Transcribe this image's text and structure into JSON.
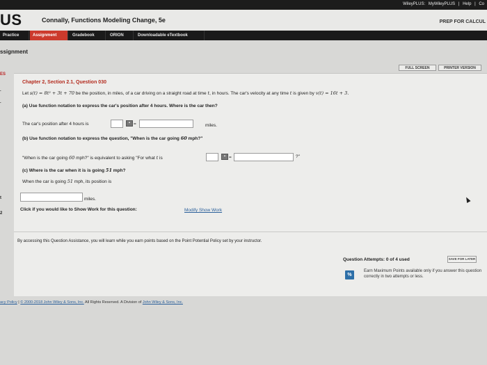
{
  "topbar": {
    "links": [
      "WileyPLUS:",
      "MyWileyPLUS",
      "|",
      "Help",
      "|",
      "Co"
    ]
  },
  "header": {
    "brand": "US",
    "course_title": "Connally, Functions Modeling Change, 5e",
    "prep": "PREP FOR CALCUL"
  },
  "nav": {
    "tabs": [
      "Practice",
      "Assignment",
      "Gradebook",
      "ORION",
      "Downloadable eTextbook"
    ],
    "active": "Assignment"
  },
  "section_label": "ssignment",
  "buttons": {
    "full_screen": "FULL SCREEN",
    "printer_version": "PRINTER VERSION"
  },
  "sidebar": {
    "top": "ES",
    "dot1": ".",
    "dot2": ".",
    "mark1": "t",
    "mark2": "2"
  },
  "question": {
    "title": "Chapter 2, Section 2.1, Question 030",
    "intro_a": "Let ",
    "position_fn": "s(t) = 8t² + 3t + 70",
    "intro_b": " be the position, in miles, of a car driving on a straight road at time ",
    "t_var": "t",
    "intro_c": ", in hours. The car's velocity at any time ",
    "intro_d": " is given by ",
    "velocity_fn": "v(t) = 16t + 3.",
    "part_a": "(a) Use function notation to express the car's position after 4 hours. Where is the car then?",
    "pos_prefix": "The car's position after 4 hours is",
    "eq": "=",
    "miles": "miles.",
    "part_b_a": "(b) Use function notation to express the question, \"When is the car going ",
    "part_b_num": "60",
    "part_b_b": " mph?\"",
    "when_a": "\"When is the car going ",
    "when_num": "60",
    "when_b": " mph?\" is equivalent to asking \"For what ",
    "when_c": " is",
    "close_q": "?\"",
    "part_c_a": "(c) Where is the car when it is is going ",
    "part_c_num": "51",
    "part_c_b": " mph?",
    "going_a": "When the car is going ",
    "going_num": "51",
    "going_b": " mph, its position is",
    "miles2": "miles.",
    "show_work_label": "Click if you would like to Show Work for this question:",
    "show_work_link": "Modify Show Work"
  },
  "assistance_note": "By accessing this Question Assistance, you will learn while you earn points based on the Point Potential Policy set by your instructor.",
  "attempts": {
    "label": "Question Attempts: 0 of 4 used",
    "save_later": "SAVE FOR LATER"
  },
  "earn": {
    "icon": "%",
    "text": "Earn Maximum Points available only if you answer this question correctly in two attempts or less."
  },
  "footer": {
    "policy": "acy Policy",
    "sep": "|",
    "copyright": "© 2000-2018 John Wiley & Sons, Inc.",
    "rights": " All Rights Reserved. A Division of ",
    "division": "John Wiley & Sons, Inc."
  },
  "colors": {
    "active_tab": "#cc3a2c",
    "question_title": "#b32a1d",
    "link": "#2a5f9a",
    "header_bg": "#1a1a1a"
  }
}
